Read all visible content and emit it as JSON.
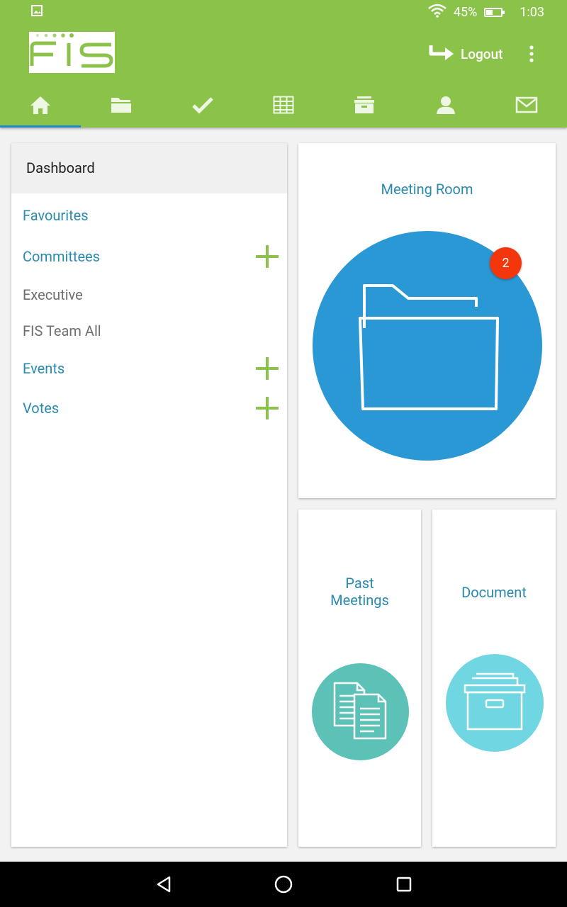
{
  "status_bar": {
    "battery_percent": "45%",
    "time": "1:03",
    "battery_level": 0.45,
    "icons": [
      "image-icon",
      "wifi-icon",
      "battery-icon"
    ]
  },
  "header": {
    "logo_text": "FIS",
    "logout_label": "Logout",
    "icons": [
      "logout-arrow-icon",
      "overflow-menu-icon"
    ]
  },
  "tabs": [
    {
      "name": "home",
      "icon": "home-icon",
      "active": true
    },
    {
      "name": "folders",
      "icon": "folder-icon",
      "active": false
    },
    {
      "name": "tasks",
      "icon": "check-icon",
      "active": false
    },
    {
      "name": "calendar",
      "icon": "grid-icon",
      "active": false
    },
    {
      "name": "archive",
      "icon": "archive-box-icon",
      "active": false
    },
    {
      "name": "profile",
      "icon": "person-icon",
      "active": false
    },
    {
      "name": "messages",
      "icon": "mail-icon",
      "active": false
    }
  ],
  "sidebar": {
    "header": "Dashboard",
    "items": [
      {
        "label": "Favourites",
        "type": "section"
      },
      {
        "label": "Committees",
        "type": "section",
        "has_add": true
      },
      {
        "label": "Executive",
        "type": "sub"
      },
      {
        "label": "FIS Team All",
        "type": "sub"
      },
      {
        "label": "Events",
        "type": "section",
        "has_add": true
      },
      {
        "label": "Votes",
        "type": "section",
        "has_add": true
      }
    ]
  },
  "tiles": {
    "meeting_room": {
      "title": "Meeting Room",
      "badge": "2",
      "icon": "folder-icon"
    },
    "past_meetings": {
      "title_line1": "Past",
      "title_line2": "Meetings",
      "icon": "documents-icon"
    },
    "document": {
      "title": "Document",
      "icon": "archive-box-icon"
    }
  },
  "colors": {
    "brand_green": "#8bc34a",
    "link_blue": "#2a8ab0",
    "meeting_blue": "#2b98d6",
    "teal": "#5cc2b8",
    "light_cyan": "#6fd6e2",
    "badge_red": "#f4360c",
    "tab_indicator": "#1e88c9"
  },
  "android_nav": {
    "icons": [
      "back-icon",
      "home-circle-icon",
      "recents-icon"
    ]
  }
}
